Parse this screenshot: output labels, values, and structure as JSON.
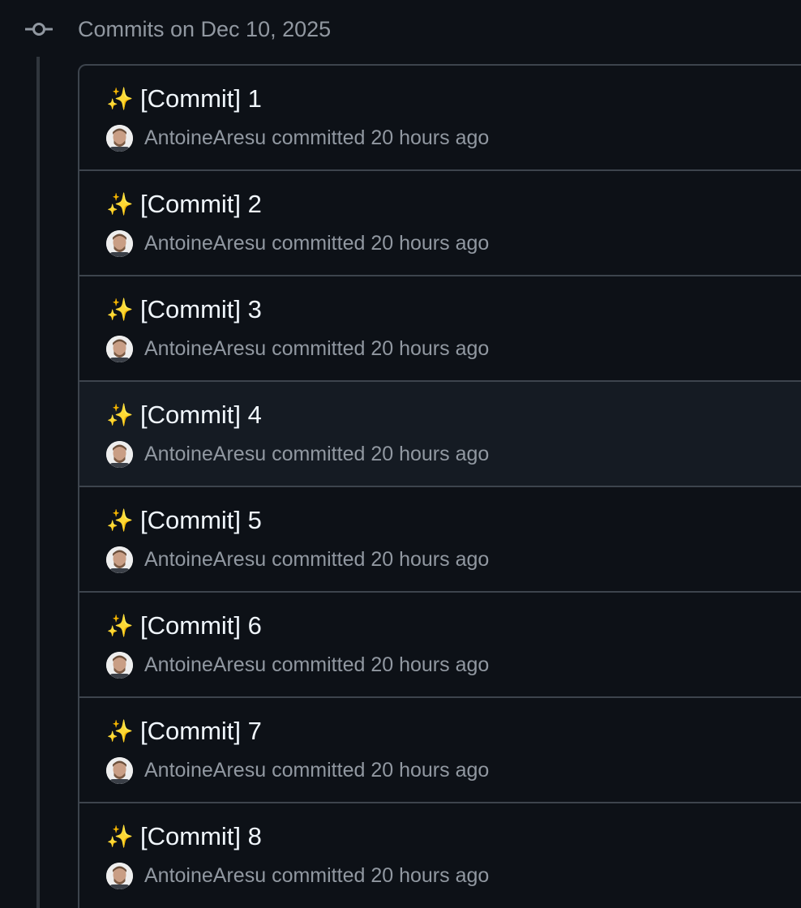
{
  "group": {
    "header": "Commits on Dec 10, 2025"
  },
  "commits": [
    {
      "title": "[Commit] 1",
      "author": "AntoineAresu",
      "action": "committed",
      "time": "20 hours ago"
    },
    {
      "title": "[Commit] 2",
      "author": "AntoineAresu",
      "action": "committed",
      "time": "20 hours ago"
    },
    {
      "title": "[Commit] 3",
      "author": "AntoineAresu",
      "action": "committed",
      "time": "20 hours ago"
    },
    {
      "title": "[Commit] 4",
      "author": "AntoineAresu",
      "action": "committed",
      "time": "20 hours ago"
    },
    {
      "title": "[Commit] 5",
      "author": "AntoineAresu",
      "action": "committed",
      "time": "20 hours ago"
    },
    {
      "title": "[Commit] 6",
      "author": "AntoineAresu",
      "action": "committed",
      "time": "20 hours ago"
    },
    {
      "title": "[Commit] 7",
      "author": "AntoineAresu",
      "action": "committed",
      "time": "20 hours ago"
    },
    {
      "title": "[Commit] 8",
      "author": "AntoineAresu",
      "action": "committed",
      "time": "20 hours ago"
    }
  ],
  "icons": {
    "commit_emoji": "sparkles-icon",
    "timeline": "git-commit-icon"
  },
  "colors": {
    "background": "#0d1117",
    "row_hover": "#151b23",
    "border": "#3d444d",
    "title_text": "#f0f6fc",
    "muted_text": "#9198a1",
    "sparkles": "#f5c542"
  }
}
